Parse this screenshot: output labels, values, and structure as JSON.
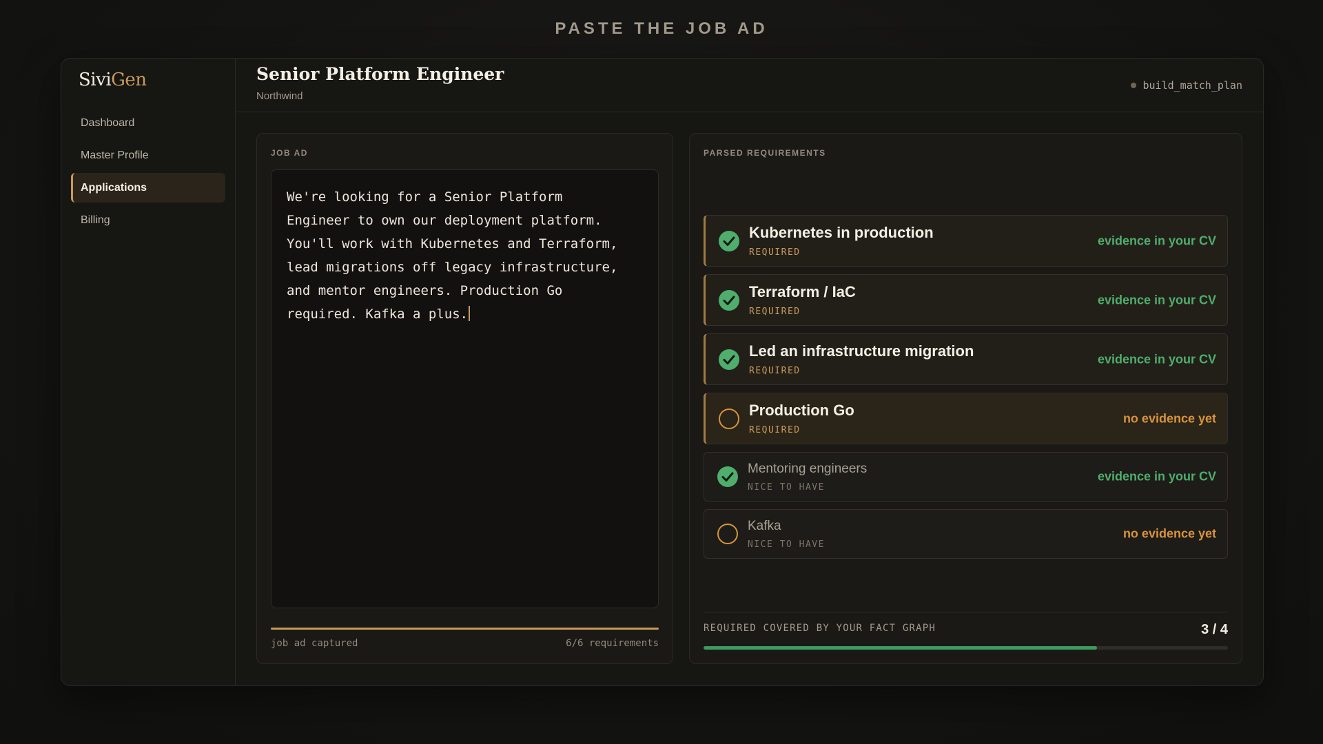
{
  "page_heading": "PASTE THE JOB AD",
  "brand": {
    "part1": "Sivi",
    "part2": "Gen",
    "accent_color": "#c99a5b"
  },
  "sidebar": {
    "items": [
      {
        "label": "Dashboard",
        "active": false
      },
      {
        "label": "Master Profile",
        "active": false
      },
      {
        "label": "Applications",
        "active": true
      },
      {
        "label": "Billing",
        "active": false
      }
    ]
  },
  "header": {
    "title": "Senior Platform Engineer",
    "company": "Northwind",
    "status": "build_match_plan"
  },
  "job_ad": {
    "label": "JOB AD",
    "text": "We're looking for a Senior Platform\nEngineer to own our deployment platform.\nYou'll work with Kubernetes and Terraform,\nlead migrations off legacy infrastructure,\nand mentor engineers. Production Go\nrequired. Kafka a plus.",
    "footer_left": "job ad captured",
    "footer_right": "6/6 requirements",
    "progress": 1.0
  },
  "requirements": {
    "label": "PARSED REQUIREMENTS",
    "items": [
      {
        "name": "Kubernetes in production",
        "tag": "REQUIRED",
        "status": "evidence in your CV",
        "has_evidence": true,
        "required": true
      },
      {
        "name": "Terraform / IaC",
        "tag": "REQUIRED",
        "status": "evidence in your CV",
        "has_evidence": true,
        "required": true
      },
      {
        "name": "Led an infrastructure migration",
        "tag": "REQUIRED",
        "status": "evidence in your CV",
        "has_evidence": true,
        "required": true
      },
      {
        "name": "Production Go",
        "tag": "REQUIRED",
        "status": "no evidence yet",
        "has_evidence": false,
        "required": true
      },
      {
        "name": "Mentoring engineers",
        "tag": "NICE TO HAVE",
        "status": "evidence in your CV",
        "has_evidence": true,
        "required": false
      },
      {
        "name": "Kafka",
        "tag": "NICE TO HAVE",
        "status": "no evidence yet",
        "has_evidence": false,
        "required": false
      }
    ],
    "coverage_label": "REQUIRED COVERED BY YOUR FACT GRAPH",
    "coverage_count": "3 / 4",
    "coverage_fraction": 0.75
  },
  "colors": {
    "evidence": "#4fae6c",
    "missing": "#d9943a",
    "accent": "#c99a5b",
    "coverage_fill": "#3f9a5e"
  }
}
